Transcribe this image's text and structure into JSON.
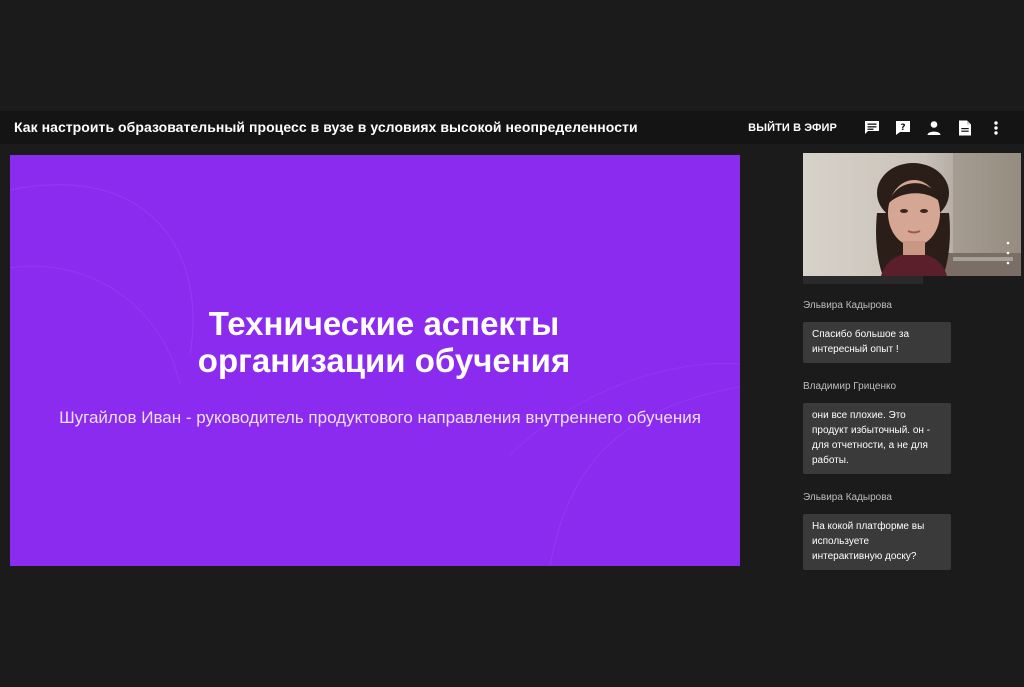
{
  "header": {
    "title": "Как настроить образовательный процесс в вузе в условиях высокой неопределенности",
    "go_live_label": "ВЫЙТИ В ЭФИР",
    "icons": [
      "chat-icon",
      "question-icon",
      "person-icon",
      "document-icon",
      "more-vert-icon"
    ]
  },
  "slide": {
    "title_line1": "Технические аспекты",
    "title_line2": "организации обучения",
    "subtitle": "Шугайлов Иван - руководитель продуктового направления внутреннего обучения",
    "background": "#8b2bf0"
  },
  "chat": {
    "messages": [
      {
        "author": "Эльвира Кадырова",
        "text": "Спасибо большое за интересный опыт !"
      },
      {
        "author": "Владимир Гриценко",
        "text": "они все плохие. Это продукт избыточный. он - для отчетности, а не для работы."
      },
      {
        "author": "Эльвира Кадырова",
        "text": "На кокой платформе вы используете интерактивную доску?"
      }
    ]
  }
}
